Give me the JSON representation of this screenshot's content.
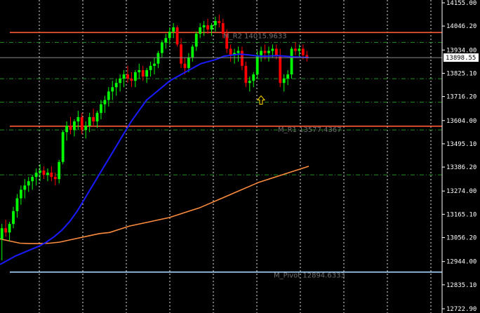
{
  "chart_data": {
    "type": "candlestick",
    "price_range": [
      12722.9,
      14155.0
    ],
    "y_ticks": [
      "14155.00",
      "14046.20",
      "13934.00",
      "13825.10",
      "13716.20",
      "13604.00",
      "13495.10",
      "13386.20",
      "13274.00",
      "13165.10",
      "13056.20",
      "12944.00",
      "12835.10",
      "12722.90"
    ],
    "current_price": "13898.55",
    "levels": [
      {
        "name": "M_R2",
        "value": 14015.9633,
        "label": "M_R2  14015.9633",
        "color": "#ff5a36",
        "style": "solid"
      },
      {
        "name": "M_R1",
        "value": 13577.4367,
        "label": "M_R1  13577.4367",
        "color": "#ff5a36",
        "style": "solid"
      },
      {
        "name": "M_Pivot",
        "value": 12894.6333,
        "label": "M_Pivot  12894.6333",
        "color": "#a8d8ff",
        "style": "solid"
      }
    ],
    "dashdot_levels": [
      13970,
      13800,
      13690,
      13560,
      13350
    ],
    "candles": [
      [
        13050,
        13120,
        12950,
        13100
      ],
      [
        13100,
        13140,
        13060,
        13080
      ],
      [
        13080,
        13130,
        13040,
        13120
      ],
      [
        13120,
        13200,
        13100,
        13180
      ],
      [
        13180,
        13260,
        13150,
        13240
      ],
      [
        13240,
        13300,
        13210,
        13280
      ],
      [
        13280,
        13330,
        13240,
        13300
      ],
      [
        13300,
        13340,
        13270,
        13320
      ],
      [
        13320,
        13350,
        13280,
        13340
      ],
      [
        13340,
        13380,
        13300,
        13360
      ],
      [
        13360,
        13400,
        13320,
        13370
      ],
      [
        13370,
        13390,
        13330,
        13350
      ],
      [
        13350,
        13380,
        13320,
        13360
      ],
      [
        13360,
        13390,
        13320,
        13340
      ],
      [
        13340,
        13360,
        13300,
        13330
      ],
      [
        13330,
        13420,
        13310,
        13410
      ],
      [
        13410,
        13560,
        13400,
        13550
      ],
      [
        13550,
        13600,
        13510,
        13580
      ],
      [
        13580,
        13620,
        13540,
        13560
      ],
      [
        13560,
        13610,
        13530,
        13600
      ],
      [
        13600,
        13650,
        13560,
        13620
      ],
      [
        13620,
        13640,
        13540,
        13560
      ],
      [
        13560,
        13600,
        13520,
        13580
      ],
      [
        13580,
        13640,
        13550,
        13620
      ],
      [
        13620,
        13660,
        13580,
        13600
      ],
      [
        13600,
        13650,
        13570,
        13640
      ],
      [
        13640,
        13700,
        13610,
        13680
      ],
      [
        13680,
        13720,
        13640,
        13700
      ],
      [
        13700,
        13760,
        13670,
        13740
      ],
      [
        13740,
        13790,
        13700,
        13760
      ],
      [
        13760,
        13800,
        13720,
        13780
      ],
      [
        13780,
        13820,
        13740,
        13800
      ],
      [
        13800,
        13840,
        13760,
        13820
      ],
      [
        13820,
        13860,
        13780,
        13800
      ],
      [
        13800,
        13830,
        13760,
        13790
      ],
      [
        13790,
        13840,
        13760,
        13830
      ],
      [
        13830,
        13870,
        13800,
        13840
      ],
      [
        13840,
        13860,
        13790,
        13810
      ],
      [
        13810,
        13850,
        13780,
        13840
      ],
      [
        13840,
        13880,
        13810,
        13860
      ],
      [
        13860,
        13900,
        13820,
        13870
      ],
      [
        13870,
        13930,
        13850,
        13920
      ],
      [
        13920,
        13980,
        13900,
        13970
      ],
      [
        13970,
        14010,
        13940,
        13990
      ],
      [
        13990,
        14040,
        13960,
        14020
      ],
      [
        14020,
        14060,
        13990,
        14040
      ],
      [
        14040,
        14050,
        13950,
        13960
      ],
      [
        13960,
        13990,
        13850,
        13870
      ],
      [
        13870,
        13900,
        13820,
        13850
      ],
      [
        13850,
        13920,
        13830,
        13900
      ],
      [
        13900,
        13960,
        13880,
        13950
      ],
      [
        13950,
        14020,
        13930,
        14010
      ],
      [
        14010,
        14060,
        13990,
        14040
      ],
      [
        14040,
        14070,
        14000,
        14050
      ],
      [
        14050,
        14080,
        14010,
        14030
      ],
      [
        14030,
        14060,
        14000,
        14050
      ],
      [
        14050,
        14090,
        14020,
        14070
      ],
      [
        14070,
        14100,
        14040,
        14060
      ],
      [
        14060,
        14080,
        13990,
        14010
      ],
      [
        14010,
        14030,
        13920,
        13940
      ],
      [
        13940,
        13960,
        13880,
        13910
      ],
      [
        13910,
        13940,
        13870,
        13920
      ],
      [
        13920,
        13950,
        13880,
        13930
      ],
      [
        13930,
        13950,
        13840,
        13860
      ],
      [
        13860,
        13880,
        13760,
        13780
      ],
      [
        13780,
        13810,
        13740,
        13790
      ],
      [
        13790,
        13830,
        13760,
        13820
      ],
      [
        13820,
        13930,
        13800,
        13910
      ],
      [
        13910,
        13950,
        13880,
        13930
      ],
      [
        13930,
        13960,
        13890,
        13920
      ],
      [
        13920,
        13950,
        13880,
        13930
      ],
      [
        13930,
        13960,
        13900,
        13940
      ],
      [
        13940,
        13960,
        13890,
        13910
      ],
      [
        13910,
        13940,
        13760,
        13780
      ],
      [
        13780,
        13820,
        13740,
        13800
      ],
      [
        13800,
        13840,
        13770,
        13820
      ],
      [
        13820,
        13950,
        13800,
        13940
      ],
      [
        13940,
        13970,
        13910,
        13930
      ],
      [
        13930,
        13960,
        13900,
        13940
      ],
      [
        13940,
        13960,
        13890,
        13910
      ],
      [
        13910,
        13930,
        13880,
        13895
      ]
    ],
    "ma_fast": [
      12930,
      12950,
      12970,
      12985,
      13000,
      13015,
      13035,
      13060,
      13090,
      13130,
      13180,
      13240,
      13300,
      13360,
      13420,
      13480,
      13540,
      13600,
      13650,
      13700,
      13730,
      13760,
      13790,
      13810,
      13830,
      13850,
      13870,
      13880,
      13890,
      13905,
      13910,
      13915,
      13912,
      13908,
      13905,
      13906,
      13908,
      13905,
      13902,
      13900,
      13899
    ],
    "ma_slow": [
      13050,
      13040,
      13030,
      13028,
      13028,
      13030,
      13035,
      13045,
      13055,
      13065,
      13075,
      13080,
      13095,
      13110,
      13120,
      13130,
      13140,
      13150,
      13165,
      13180,
      13195,
      13215,
      13235,
      13255,
      13275,
      13295,
      13315,
      13330,
      13345,
      13360,
      13375,
      13390
    ],
    "colors": {
      "background": "#000000",
      "bull": "#00ff00",
      "bear": "#ff0000",
      "ma_fast": "#1a1aff",
      "ma_slow": "#ff8c3c",
      "grid": "#ffffff",
      "dashdot": "#1f8f1f",
      "axis_line": "#ffffff",
      "current_line": "#8c8c8c",
      "current_tag_bg": "#ffffff",
      "current_tag_text": "#000000",
      "arrow": "#ffd700"
    }
  }
}
